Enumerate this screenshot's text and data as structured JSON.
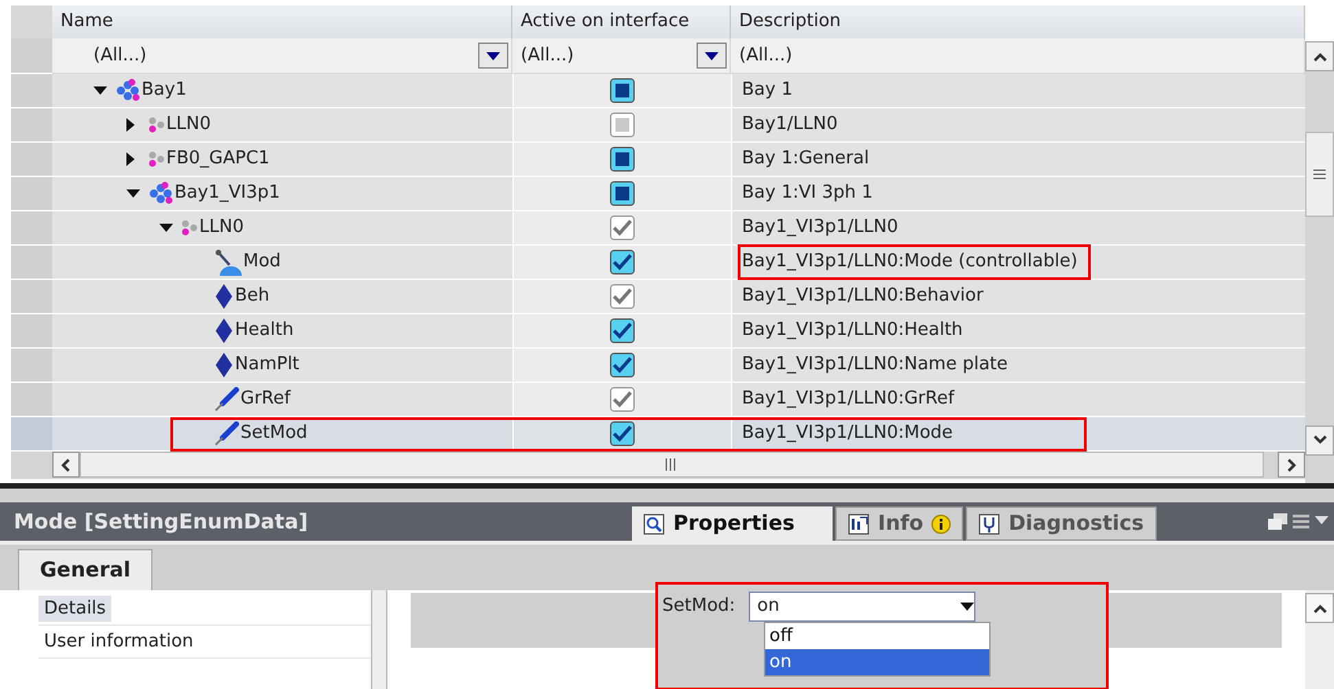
{
  "table": {
    "columns": [
      "Name",
      "Active on interface",
      "Description"
    ],
    "filters": [
      "(All...)",
      "(All...)",
      "(All...)"
    ],
    "rows": [
      {
        "name": "Bay1",
        "kind": "cluster",
        "expanded": true,
        "active": {
          "kind": "square",
          "disabled": false
        },
        "description": "Bay 1",
        "selected": false,
        "children": [
          {
            "name": "LLN0",
            "kind": "node",
            "expanded": false,
            "active": {
              "kind": "square",
              "disabled": true
            },
            "description": "Bay1/LLN0",
            "selected": false
          },
          {
            "name": "FB0_GAPC1",
            "kind": "node",
            "expanded": false,
            "active": {
              "kind": "square",
              "disabled": false
            },
            "description": "Bay 1:General",
            "selected": false
          },
          {
            "name": "Bay1_VI3p1",
            "kind": "cluster",
            "expanded": true,
            "active": {
              "kind": "square",
              "disabled": false
            },
            "description": "Bay 1:VI 3ph 1",
            "selected": false,
            "children": [
              {
                "name": "LLN0",
                "kind": "node",
                "expanded": true,
                "active": {
                  "kind": "tick",
                  "disabled": true
                },
                "description": "Bay1_VI3p1/LLN0",
                "selected": false,
                "children": [
                  {
                    "name": "Mod",
                    "kind": "switch",
                    "active": {
                      "kind": "tick",
                      "disabled": false
                    },
                    "description": "Bay1_VI3p1/LLN0:Mode (controllable)",
                    "selected": false,
                    "outline": {
                      "kind": "description"
                    }
                  },
                  {
                    "name": "Beh",
                    "kind": "diamond",
                    "active": {
                      "kind": "tick",
                      "disabled": true
                    },
                    "description": "Bay1_VI3p1/LLN0:Behavior",
                    "selected": false
                  },
                  {
                    "name": "Health",
                    "kind": "diamond",
                    "active": {
                      "kind": "tick",
                      "disabled": false
                    },
                    "description": "Bay1_VI3p1/LLN0:Health",
                    "selected": false
                  },
                  {
                    "name": "NamPlt",
                    "kind": "diamond",
                    "active": {
                      "kind": "tick",
                      "disabled": false
                    },
                    "description": "Bay1_VI3p1/LLN0:Name plate",
                    "selected": false
                  },
                  {
                    "name": "GrRef",
                    "kind": "pen",
                    "active": {
                      "kind": "tick",
                      "disabled": true
                    },
                    "description": "Bay1_VI3p1/LLN0:GrRef",
                    "selected": false
                  },
                  {
                    "name": "SetMod",
                    "kind": "pen",
                    "active": {
                      "kind": "tick",
                      "disabled": false
                    },
                    "description": "Bay1_VI3p1/LLN0:Mode",
                    "selected": true,
                    "outline": {
                      "kind": "row"
                    }
                  }
                ]
              }
            ]
          }
        ]
      }
    ]
  },
  "inspector": {
    "title": "Mode [SettingEnumData]",
    "tabs": [
      {
        "label": "Properties",
        "kind": "magnifier",
        "selected": true
      },
      {
        "label": "Info",
        "kind": "info",
        "selected": false
      },
      {
        "label": "Diagnostics",
        "kind": "diagnostics",
        "selected": false
      }
    ],
    "section_tabs": [
      {
        "label": "General",
        "selected": true
      }
    ],
    "nav": [
      {
        "label": "Details",
        "selected": true
      },
      {
        "label": "User information",
        "selected": false
      }
    ],
    "field": {
      "label": "SetMod:",
      "value": "on",
      "options": [
        {
          "label": "off",
          "selected": false
        },
        {
          "label": "on",
          "selected": true
        }
      ]
    }
  }
}
